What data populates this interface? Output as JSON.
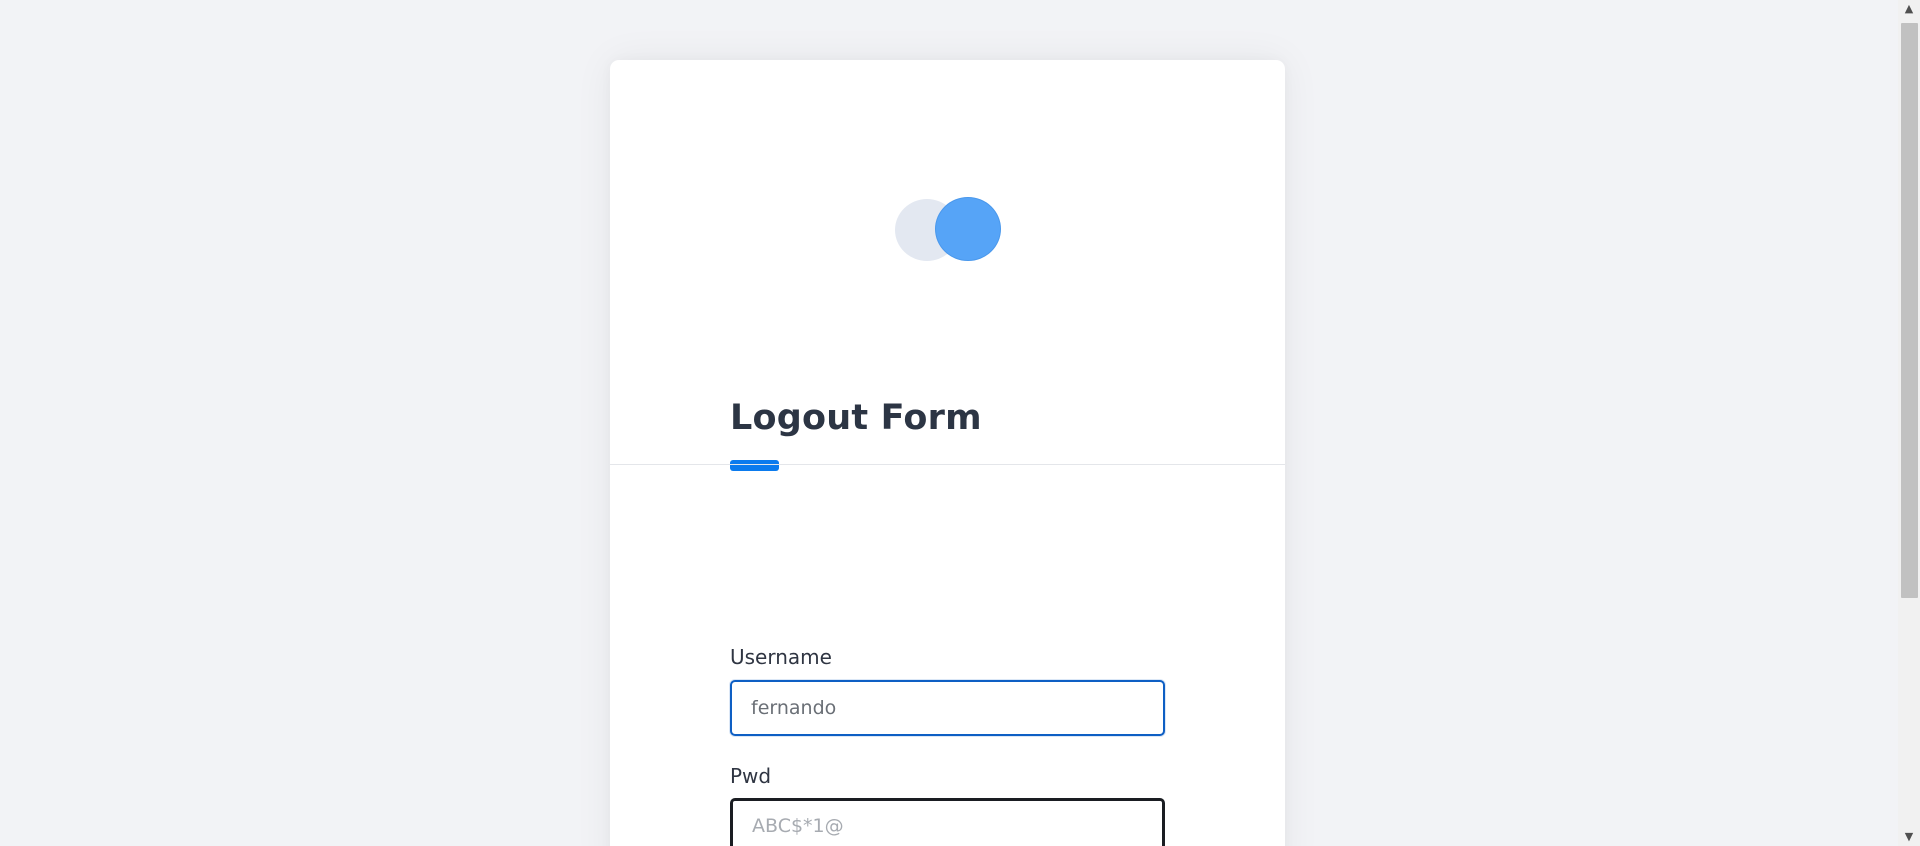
{
  "form": {
    "title": "Logout Form",
    "username_label": "Username",
    "username_value": "fernando",
    "password_label": "Pwd",
    "password_placeholder": "ABC$*1@"
  },
  "colors": {
    "accent": "#0b7bee",
    "logo_front": "#56a4f7",
    "logo_back": "#e3e8f1",
    "title_text": "#2c3544",
    "page_background": "#f2f3f6"
  },
  "icons": {
    "logo": "overlapping-circles-logo",
    "scroll_up": "triangle-up",
    "scroll_down": "triangle-down"
  }
}
